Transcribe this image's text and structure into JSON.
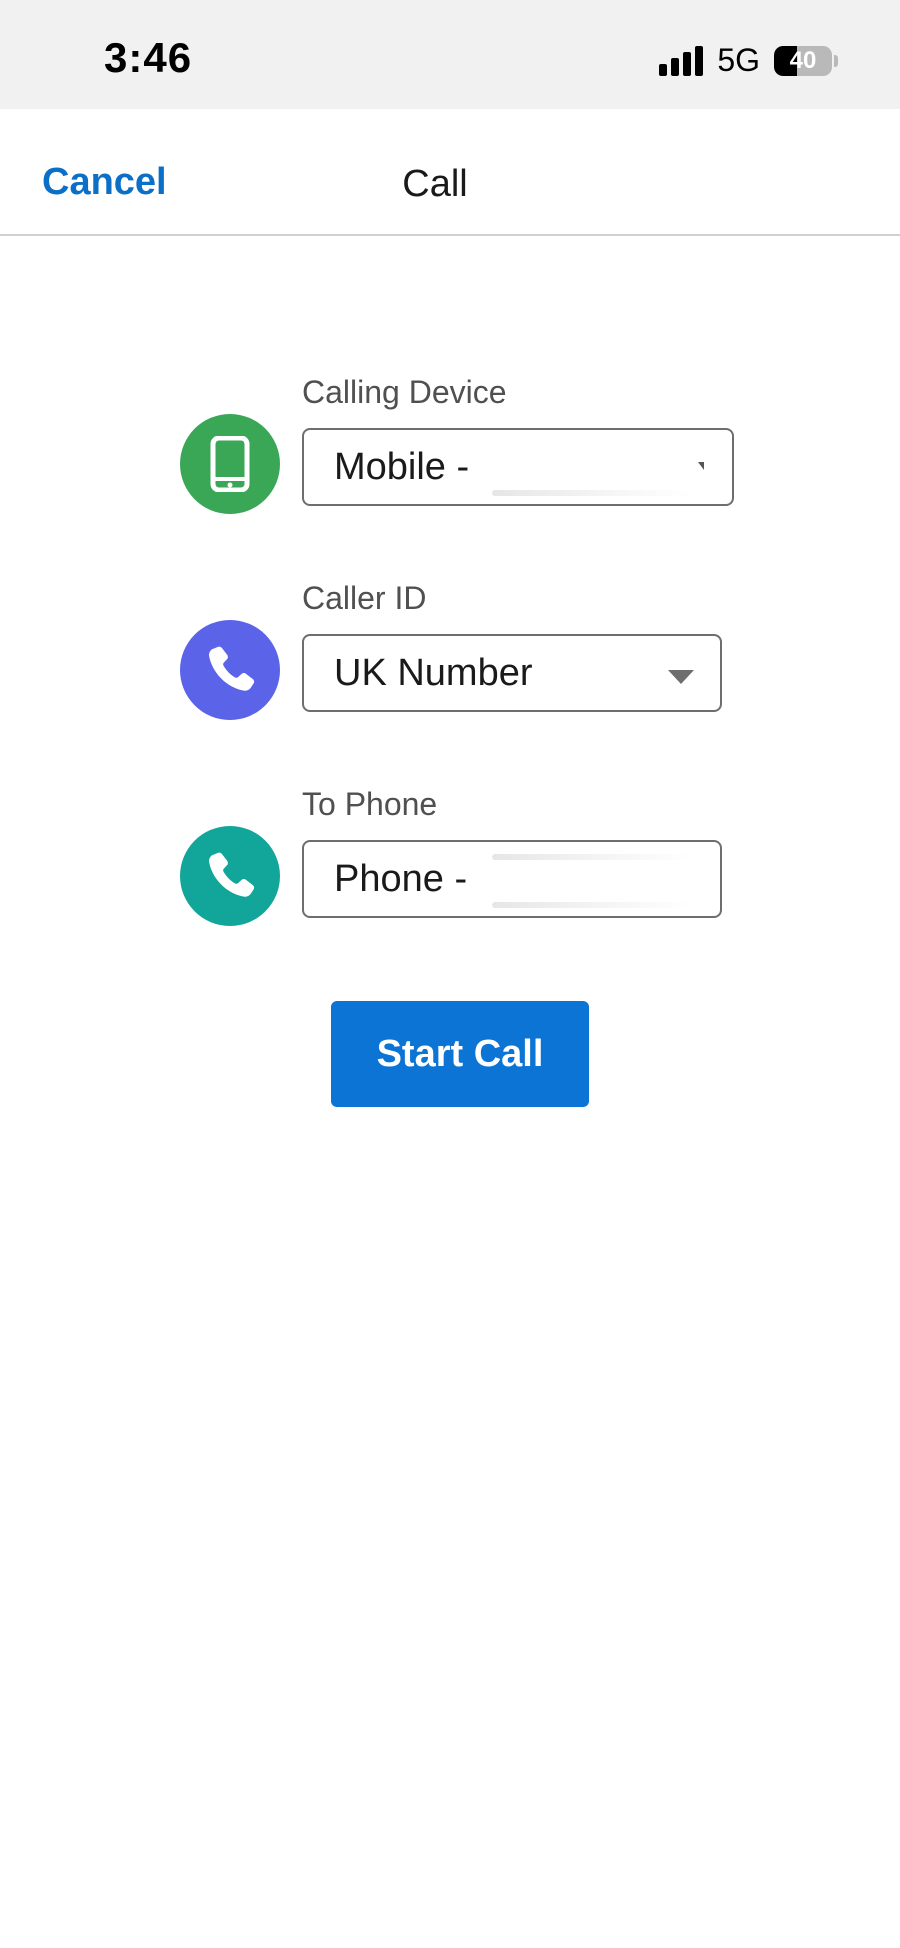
{
  "status_bar": {
    "time": "3:46",
    "network": "5G",
    "battery_level": "40",
    "battery_fraction": 0.4
  },
  "nav": {
    "cancel_label": "Cancel",
    "title": "Call"
  },
  "form": {
    "calling_device": {
      "label": "Calling Device",
      "value": "Mobile -",
      "icon": "mobile-phone-icon",
      "icon_color": "#3aa757"
    },
    "caller_id": {
      "label": "Caller ID",
      "value": "UK Number",
      "icon": "phone-handset-icon",
      "icon_color": "#5b63e9"
    },
    "to_phone": {
      "label": "To Phone",
      "value": "Phone -",
      "icon": "phone-handset-icon",
      "icon_color": "#12a69a"
    }
  },
  "actions": {
    "start_call_label": "Start Call",
    "accent": "#0b74d4"
  }
}
